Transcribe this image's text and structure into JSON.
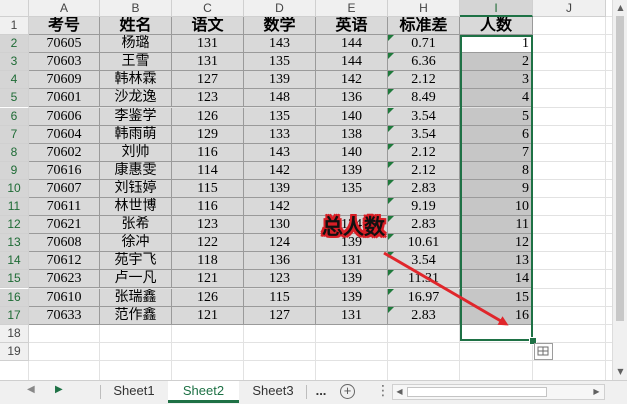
{
  "columns": [
    "A",
    "B",
    "C",
    "D",
    "E",
    "H",
    "I",
    "J"
  ],
  "active_column": "I",
  "row_numbers": [
    "1",
    "2",
    "3",
    "4",
    "5",
    "6",
    "7",
    "8",
    "9",
    "10",
    "11",
    "12",
    "13",
    "14",
    "15",
    "16",
    "17",
    "18",
    "19"
  ],
  "table": {
    "headers": [
      "考号",
      "姓名",
      "语文",
      "数学",
      "英语",
      "标准差",
      "人数"
    ],
    "rows": [
      [
        "70605",
        "杨璐",
        "131",
        "143",
        "144",
        "0.71",
        "1"
      ],
      [
        "70603",
        "王雪",
        "131",
        "135",
        "144",
        "6.36",
        "2"
      ],
      [
        "70609",
        "韩林霖",
        "127",
        "139",
        "142",
        "2.12",
        "3"
      ],
      [
        "70601",
        "沙龙逸",
        "123",
        "148",
        "136",
        "8.49",
        "4"
      ],
      [
        "70606",
        "李鉴学",
        "126",
        "135",
        "140",
        "3.54",
        "5"
      ],
      [
        "70604",
        "韩雨萌",
        "129",
        "133",
        "138",
        "3.54",
        "6"
      ],
      [
        "70602",
        "刘帅",
        "116",
        "143",
        "140",
        "2.12",
        "7"
      ],
      [
        "70616",
        "康惠雯",
        "114",
        "142",
        "139",
        "2.12",
        "8"
      ],
      [
        "70607",
        "刘钰婷",
        "115",
        "139",
        "135",
        "2.83",
        "9"
      ],
      [
        "70611",
        "林世博",
        "116",
        "142",
        "",
        "9.19",
        "10"
      ],
      [
        "70621",
        "张希",
        "123",
        "130",
        "134",
        "2.83",
        "11"
      ],
      [
        "70608",
        "徐冲",
        "122",
        "124",
        "139",
        "10.61",
        "12"
      ],
      [
        "70612",
        "苑宇飞",
        "118",
        "136",
        "131",
        "3.54",
        "13"
      ],
      [
        "70623",
        "卢一凡",
        "121",
        "123",
        "139",
        "11.31",
        "14"
      ],
      [
        "70610",
        "张瑞鑫",
        "126",
        "115",
        "139",
        "16.97",
        "15"
      ],
      [
        "70633",
        "范作鑫",
        "121",
        "127",
        "131",
        "2.83",
        "16"
      ]
    ]
  },
  "annotation": "总人数",
  "sheet_tabs": [
    "Sheet1",
    "Sheet2",
    "Sheet3"
  ],
  "active_sheet": "Sheet2",
  "more_tabs": "...",
  "add_sheet": "+",
  "colors": {
    "selection_border": "#1e7145",
    "annotation_red": "#d81f26",
    "cell_gray": "#d9d9d9"
  }
}
